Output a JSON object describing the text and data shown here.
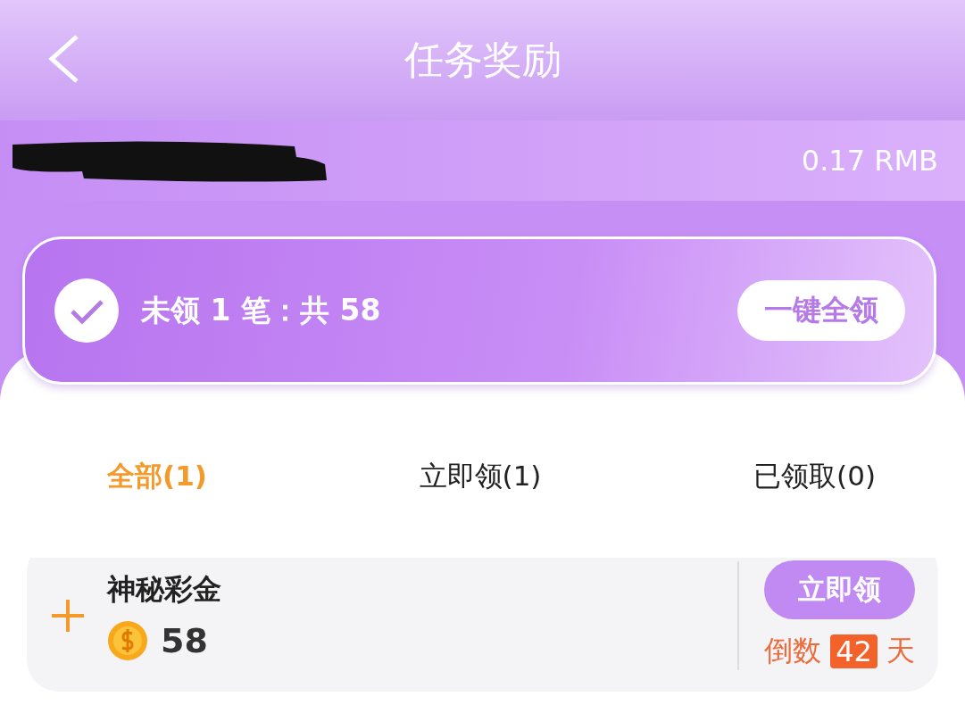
{
  "header": {
    "title": "任务奖励"
  },
  "account": {
    "balance": "0.17 RMB"
  },
  "summary": {
    "checked": true,
    "text": "未领 1 笔：共 58",
    "button": "一键全领"
  },
  "tabs": [
    {
      "label": "全部(1)",
      "selected": true
    },
    {
      "label": "立即领(1)",
      "selected": false
    },
    {
      "label": "已领取(0)",
      "selected": false
    }
  ],
  "rewards": [
    {
      "title": "神秘彩金",
      "amount": "58",
      "button": "立即领",
      "countdown_prefix": "倒数",
      "days": "42",
      "countdown_suffix": "天"
    }
  ]
}
